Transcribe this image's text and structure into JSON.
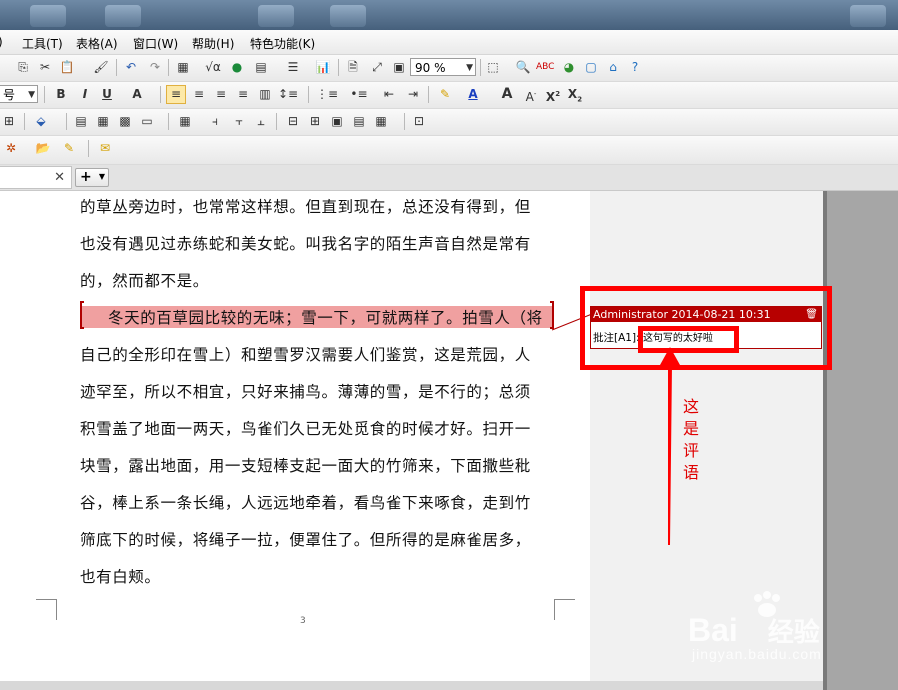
{
  "menu": [
    "工具(T)",
    "表格(A)",
    "窗口(W)",
    "帮助(H)",
    "特色功能(K)"
  ],
  "toolbar": {
    "zoom": "90 %",
    "font_size": "号",
    "format_buttons": [
      "B",
      "I",
      "U",
      "A",
      "A",
      "A",
      "X",
      "X"
    ]
  },
  "tabs": {
    "add_symbol": "+"
  },
  "document": {
    "lines": [
      "的草丛旁边时，也常常这样想。但直到现在，总还没有得到，但",
      "也没有遇见过赤练蛇和美女蛇。叫我名字的陌生声音自然是常有",
      "的，然而都不是。",
      "冬天的百草园比较的无味；雪一下，可就两样了。拍雪人（将",
      "自己的全形印在雪上）和塑雪罗汉需要人们鉴赏，这是荒园，人",
      "迹罕至，所以不相宜，只好来捕鸟。薄薄的雪，是不行的；总须",
      "积雪盖了地面一两天，鸟雀们久已无处觅食的时候才好。扫开一",
      "块雪，露出地面，用一支短棒支起一面大的竹筛来，下面撒些秕",
      "谷，棒上系一条长绳，人远远地牵着，看鸟雀下来啄食，走到竹",
      "筛底下的时候，将绳子一拉，便罩住了。但所得的是麻雀居多，",
      "也有白颊。"
    ],
    "page_number": "3"
  },
  "comment": {
    "author_date": "Administrator 2014-08-21 10:31",
    "label": "批注[A1]:",
    "text": "这句写的太好啦"
  },
  "annotation": [
    "这",
    "是",
    "评",
    "语"
  ],
  "watermark": {
    "brand": "Bai",
    "cn": "经验",
    "url": "jingyan.baidu.com"
  },
  "colors": {
    "highlight": "#f0a0a0",
    "comment_red": "#b70000",
    "callout": "#ff0000"
  }
}
